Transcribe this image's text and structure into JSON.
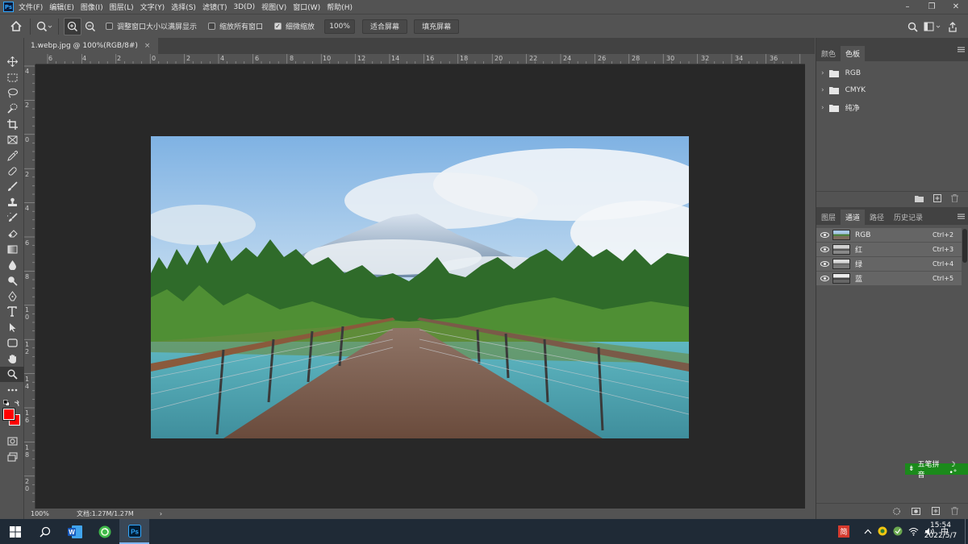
{
  "app": {
    "logo": "Ps"
  },
  "menu": [
    "文件(F)",
    "编辑(E)",
    "图像(I)",
    "图层(L)",
    "文字(Y)",
    "选择(S)",
    "滤镜(T)",
    "3D(D)",
    "视图(V)",
    "窗口(W)",
    "帮助(H)"
  ],
  "options": {
    "resize_windows": "调整窗口大小以满屏显示",
    "zoom_all": "缩放所有窗口",
    "scrubby_zoom": "细微缩放",
    "zoom_value": "100%",
    "fit_screen": "适合屏幕",
    "fill_screen": "填充屏幕"
  },
  "document": {
    "tab_title": "1.webp.jpg @ 100%(RGB/8#)",
    "close": "×"
  },
  "ruler": {
    "h_labels": [
      "6",
      "4",
      "2",
      "0",
      "2",
      "4",
      "6",
      "8",
      "10",
      "12",
      "14",
      "16",
      "18",
      "20",
      "22",
      "24",
      "26",
      "28",
      "30",
      "32",
      "34",
      "36"
    ],
    "v_labels": [
      "4",
      "2",
      "0",
      "2",
      "4",
      "6",
      "8",
      "1 0",
      "1 2",
      "1 4",
      "1 6",
      "1 8",
      "2 0"
    ]
  },
  "status": {
    "zoom": "100%",
    "doc_size": "文档:1.27M/1.27M",
    "arrow": "›"
  },
  "swatches_panel": {
    "tabs": [
      "颜色",
      "色板"
    ],
    "groups": [
      "RGB",
      "CMYK",
      "纯净"
    ]
  },
  "channels_panel": {
    "tabs": [
      "图层",
      "通道",
      "路径",
      "历史记录"
    ],
    "channels": [
      {
        "name": "RGB",
        "shortcut": "Ctrl+2"
      },
      {
        "name": "红",
        "shortcut": "Ctrl+3"
      },
      {
        "name": "绿",
        "shortcut": "Ctrl+4"
      },
      {
        "name": "蓝",
        "shortcut": "Ctrl+5"
      }
    ]
  },
  "ime": {
    "label": "五笔拼音"
  },
  "taskbar": {
    "time": "15:54",
    "date": "2022/5/7",
    "ime_char": "简"
  },
  "colors": {
    "foreground": "#ff0000",
    "background": "#ff0000",
    "accent": "#31a8ff",
    "canvas_bg": "#282828",
    "ime_green": "#1b8a1b"
  }
}
